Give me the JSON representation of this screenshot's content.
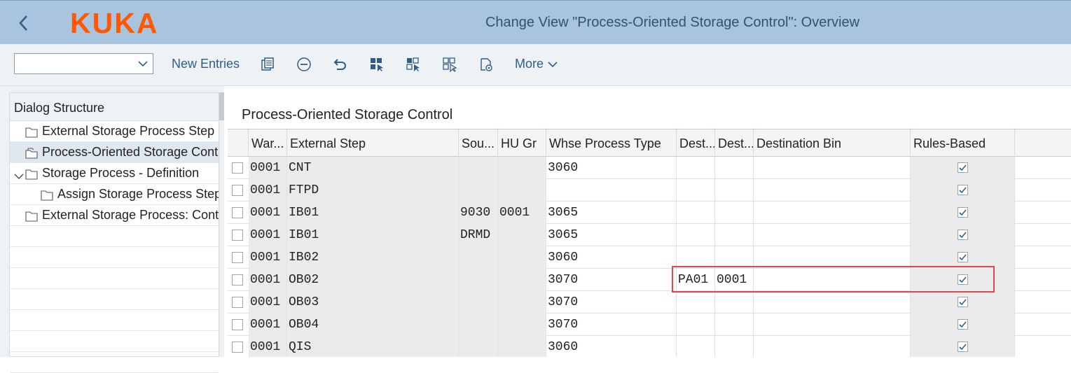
{
  "header": {
    "title": "Change View \"Process-Oriented Storage Control\": Overview",
    "logo_text": "KUKA",
    "logo_color": "#ff5800",
    "back_icon": "chevron-left-icon"
  },
  "toolbar": {
    "variant_select_value": "",
    "new_entries_label": "New Entries",
    "more_label": "More",
    "icons": [
      "copy-icon",
      "delete-icon",
      "undo-icon",
      "select-all-icon",
      "select-block-icon",
      "deselect-all-icon",
      "settings-icon"
    ]
  },
  "dialog_structure": {
    "title": "Dialog Structure",
    "items": [
      {
        "label": "External Storage Process Step",
        "level": 0,
        "selected": false,
        "expanded": false
      },
      {
        "label": "Process-Oriented Storage Contr",
        "level": 0,
        "selected": true,
        "expanded": false
      },
      {
        "label": "Storage Process - Definition",
        "level": 0,
        "selected": false,
        "expanded": true
      },
      {
        "label": "Assign Storage Process Step",
        "level": 1,
        "selected": false,
        "expanded": false
      },
      {
        "label": "External Storage Process: Contr",
        "level": 0,
        "selected": false,
        "expanded": false
      }
    ]
  },
  "table": {
    "title": "Process-Oriented Storage Control",
    "columns": [
      "War...",
      "External Step",
      "Sou...",
      "HU Gr",
      "Whse Process Type",
      "Dest...",
      "Dest...",
      "Destination Bin",
      "Rules-Based"
    ],
    "rows": [
      {
        "warehouse": "0001",
        "ext_step": "CNT",
        "source": "",
        "hu_group": "",
        "process_type": "3060",
        "dest1": "",
        "dest2": "",
        "dest_bin": "",
        "rules_based": true
      },
      {
        "warehouse": "0001",
        "ext_step": "FTPD",
        "source": "",
        "hu_group": "",
        "process_type": "",
        "dest1": "",
        "dest2": "",
        "dest_bin": "",
        "rules_based": true
      },
      {
        "warehouse": "0001",
        "ext_step": "IB01",
        "source": "9030",
        "hu_group": "0001",
        "process_type": "3065",
        "dest1": "",
        "dest2": "",
        "dest_bin": "",
        "rules_based": true
      },
      {
        "warehouse": "0001",
        "ext_step": "IB01",
        "source": "DRMD",
        "hu_group": "",
        "process_type": "3065",
        "dest1": "",
        "dest2": "",
        "dest_bin": "",
        "rules_based": true
      },
      {
        "warehouse": "0001",
        "ext_step": "IB02",
        "source": "",
        "hu_group": "",
        "process_type": "3060",
        "dest1": "",
        "dest2": "",
        "dest_bin": "",
        "rules_based": true
      },
      {
        "warehouse": "0001",
        "ext_step": "OB02",
        "source": "",
        "hu_group": "",
        "process_type": "3070",
        "dest1": "PA01",
        "dest2": "0001",
        "dest_bin": "",
        "rules_based": true
      },
      {
        "warehouse": "0001",
        "ext_step": "OB03",
        "source": "",
        "hu_group": "",
        "process_type": "3070",
        "dest1": "",
        "dest2": "",
        "dest_bin": "",
        "rules_based": true
      },
      {
        "warehouse": "0001",
        "ext_step": "OB04",
        "source": "",
        "hu_group": "",
        "process_type": "3070",
        "dest1": "",
        "dest2": "",
        "dest_bin": "",
        "rules_based": true
      },
      {
        "warehouse": "0001",
        "ext_step": "QIS",
        "source": "",
        "hu_group": "",
        "process_type": "3060",
        "dest1": "",
        "dest2": "",
        "dest_bin": "",
        "rules_based": true
      }
    ]
  },
  "highlight_color": "#e8434a"
}
